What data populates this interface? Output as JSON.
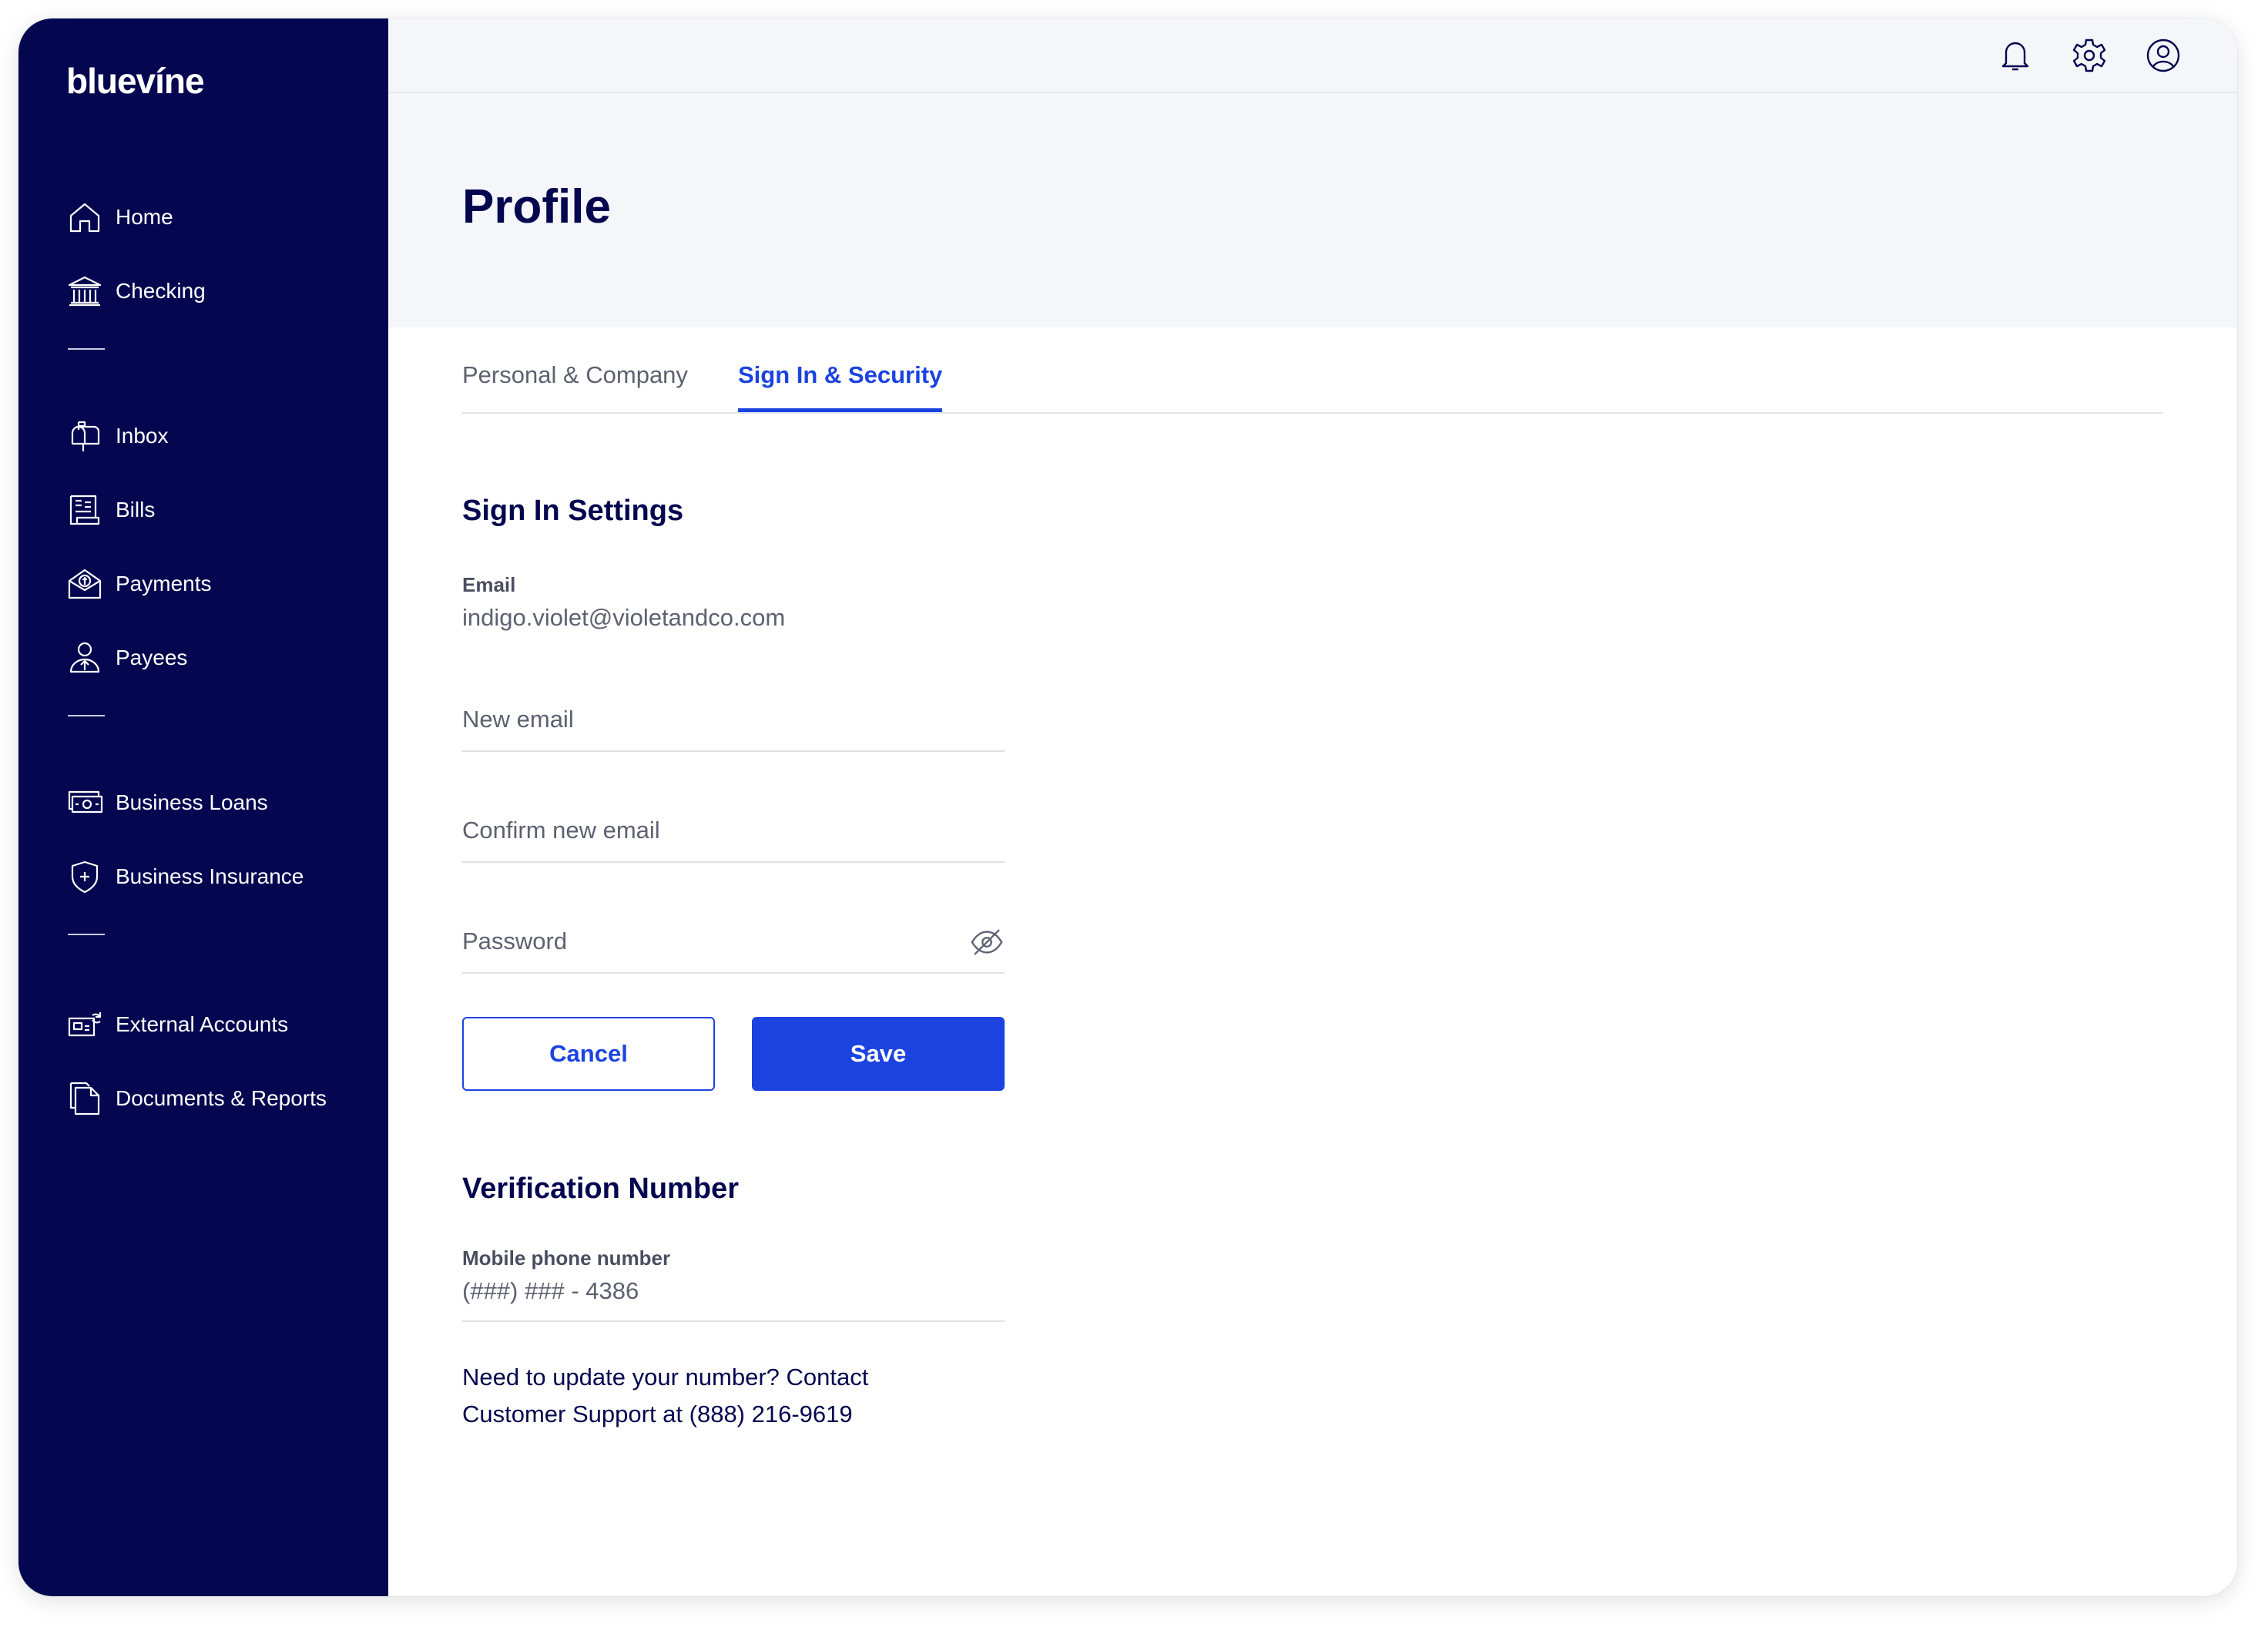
{
  "brand": {
    "logo_text": "bluevíne",
    "sidebar_bg": "#04064f",
    "accent": "#1c43e0"
  },
  "sidebar": {
    "items": [
      {
        "label": "Home",
        "icon": "home-icon"
      },
      {
        "label": "Checking",
        "icon": "bank-icon"
      },
      {
        "label": "Inbox",
        "icon": "mailbox-icon"
      },
      {
        "label": "Bills",
        "icon": "bill-icon"
      },
      {
        "label": "Payments",
        "icon": "payment-icon"
      },
      {
        "label": "Payees",
        "icon": "payee-icon"
      },
      {
        "label": "Business Loans",
        "icon": "cash-icon"
      },
      {
        "label": "Business Insurance",
        "icon": "shield-icon"
      },
      {
        "label": "External Accounts",
        "icon": "external-account-icon"
      },
      {
        "label": "Documents & Reports",
        "icon": "documents-icon"
      }
    ]
  },
  "topbar": {
    "icons": [
      "bell-icon",
      "gear-icon",
      "user-icon"
    ]
  },
  "page": {
    "title": "Profile"
  },
  "tabs": [
    {
      "label": "Personal & Company",
      "active": false
    },
    {
      "label": "Sign In & Security",
      "active": true
    }
  ],
  "sign_in": {
    "title": "Sign In Settings",
    "email_label": "Email",
    "email_value": "indigo.violet@violetandco.com",
    "new_email_placeholder": "New email",
    "confirm_email_placeholder": "Confirm new email",
    "password_placeholder": "Password",
    "cancel_label": "Cancel",
    "save_label": "Save"
  },
  "verification": {
    "title": "Verification Number",
    "phone_label": "Mobile phone number",
    "phone_value": "(###) ### - 4386",
    "help_text": "Need to update your number? Contact Customer Support at (888) 216-9619"
  }
}
